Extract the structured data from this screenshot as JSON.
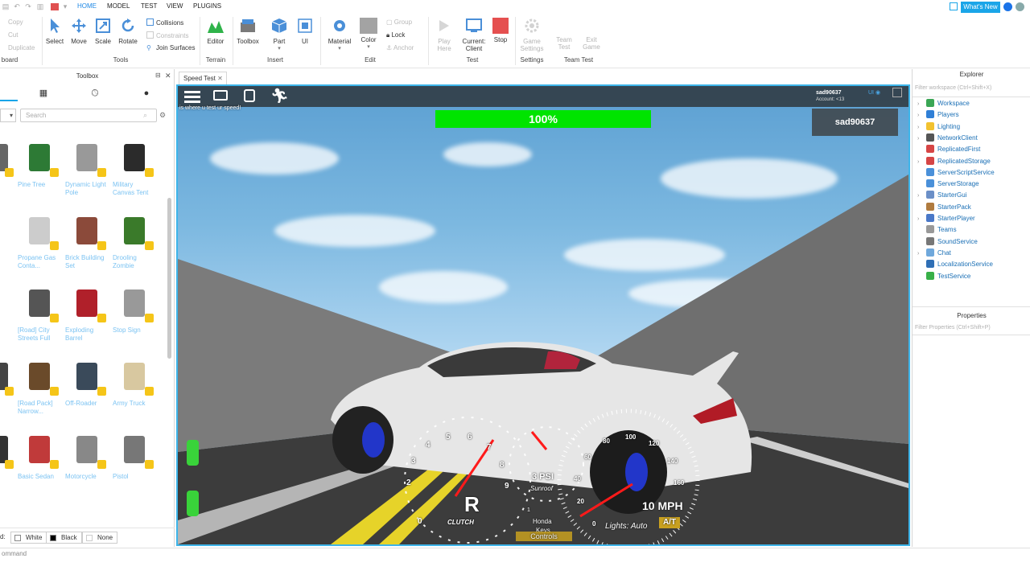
{
  "menu": {
    "tabs": [
      "HOME",
      "MODEL",
      "TEST",
      "VIEW",
      "PLUGINS"
    ],
    "active": "HOME",
    "whats_new": "What's New"
  },
  "ribbon": {
    "clipboard": {
      "copy": "Copy",
      "cut": "Cut",
      "duplicate": "Duplicate",
      "label": "board"
    },
    "tools": {
      "select": "Select",
      "move": "Move",
      "scale": "Scale",
      "rotate": "Rotate",
      "collisions": "Collisions",
      "constraints": "Constraints",
      "join_surfaces": "Join Surfaces",
      "label": "Tools"
    },
    "terrain": {
      "editor": "Editor",
      "label": "Terrain"
    },
    "insert": {
      "toolbox": "Toolbox",
      "part": "Part",
      "ui": "UI",
      "label": "Insert"
    },
    "edit": {
      "material": "Material",
      "color": "Color",
      "group": "Group",
      "lock": "Lock",
      "anchor": "Anchor",
      "label": "Edit"
    },
    "test": {
      "play_here_1": "Play",
      "play_here_2": "Here",
      "current_client_1": "Current:",
      "current_client_2": "Client",
      "stop": "Stop",
      "label": "Test"
    },
    "settings": {
      "game_settings_1": "Game",
      "game_settings_2": "Settings",
      "label": "Settings"
    },
    "team_test": {
      "team_test_1": "Team",
      "team_test_2": "Test",
      "exit_game_1": "Exit",
      "exit_game_2": "Game",
      "label": "Team Test"
    }
  },
  "toolbox": {
    "title": "Toolbox",
    "search_placeholder": "Search",
    "items": [
      {
        "label": "...ion",
        "col": 0,
        "row": 0
      },
      {
        "label": "Pine Tree",
        "col": 1,
        "row": 0
      },
      {
        "label": "Dynamic Light Pole",
        "col": 2,
        "row": 0
      },
      {
        "label": "Military Canvas Tent",
        "col": 3,
        "row": 0
      },
      {
        "label": "Propane Gas Conta...",
        "col": 1,
        "row": 1
      },
      {
        "label": "Brick Building Set",
        "col": 2,
        "row": 1
      },
      {
        "label": "Drooling Zombie",
        "col": 3,
        "row": 1
      },
      {
        "label": "[Road] City Streets Full",
        "col": 1,
        "row": 2
      },
      {
        "label": "Exploding Barrel",
        "col": 2,
        "row": 2
      },
      {
        "label": "Stop Sign",
        "col": 3,
        "row": 2
      },
      {
        "label": "ck] ...d...",
        "col": 0,
        "row": 3
      },
      {
        "label": "[Road Pack] Narrow...",
        "col": 1,
        "row": 3
      },
      {
        "label": "Off-Roader",
        "col": 2,
        "row": 3
      },
      {
        "label": "Army Truck",
        "col": 3,
        "row": 3
      },
      {
        "label": "ter",
        "col": 0,
        "row": 4
      },
      {
        "label": "Basic Sedan",
        "col": 1,
        "row": 4
      },
      {
        "label": "Motorcycle",
        "col": 2,
        "row": 4
      },
      {
        "label": "Pistol",
        "col": 3,
        "row": 4
      }
    ],
    "footer": {
      "prefix": "d:",
      "white": "White",
      "black": "Black",
      "none": "None"
    }
  },
  "viewport": {
    "tab_label": "Speed Test",
    "progress_text": "100%",
    "progress_fraction": 1.0,
    "player_name": "sad90637",
    "account_name": "sad90637",
    "account_sub": "Account: <13",
    "chat_line": "is where u test ur speed!",
    "hud": {
      "gear": "R",
      "clutch": "CLUTCH",
      "boost": "3 PSI",
      "sunroof": "Sunroof",
      "speed": "10 MPH",
      "lights": "Lights: Auto",
      "transmission": "A/T",
      "honda": "Honda",
      "keys": "Keys",
      "controls": "Controls",
      "one": "1",
      "tach_ticks": [
        "0",
        "1",
        "2",
        "3",
        "4",
        "5",
        "6",
        "7",
        "8",
        "9"
      ],
      "speed_ticks": [
        "0",
        "20",
        "40",
        "60",
        "80",
        "100",
        "120",
        "140",
        "160"
      ]
    }
  },
  "explorer": {
    "title": "Explorer",
    "filter_placeholder": "Filter workspace (Ctrl+Shift+X)",
    "items": [
      {
        "label": "Workspace",
        "expandable": true,
        "color": "#3aa655"
      },
      {
        "label": "Players",
        "expandable": true,
        "color": "#2f7fd6"
      },
      {
        "label": "Lighting",
        "expandable": true,
        "color": "#f2c230"
      },
      {
        "label": "NetworkClient",
        "expandable": true,
        "color": "#555555"
      },
      {
        "label": "ReplicatedFirst",
        "expandable": false,
        "color": "#d64545"
      },
      {
        "label": "ReplicatedStorage",
        "expandable": true,
        "color": "#d64545"
      },
      {
        "label": "ServerScriptService",
        "expandable": false,
        "color": "#4a90d9"
      },
      {
        "label": "ServerStorage",
        "expandable": false,
        "color": "#4a90d9"
      },
      {
        "label": "StarterGui",
        "expandable": true,
        "color": "#6b8fc7"
      },
      {
        "label": "StarterPack",
        "expandable": false,
        "color": "#b07b3f"
      },
      {
        "label": "StarterPlayer",
        "expandable": true,
        "color": "#4a78c8"
      },
      {
        "label": "Teams",
        "expandable": false,
        "color": "#999999"
      },
      {
        "label": "SoundService",
        "expandable": false,
        "color": "#777777"
      },
      {
        "label": "Chat",
        "expandable": true,
        "color": "#6fa8dc"
      },
      {
        "label": "LocalizationService",
        "expandable": false,
        "color": "#2f6fb5"
      },
      {
        "label": "TestService",
        "expandable": false,
        "color": "#38b048"
      }
    ],
    "properties_title": "Properties",
    "properties_filter": "Filter Properties (Ctrl+Shift+P)"
  },
  "command_bar": {
    "placeholder": "ommand"
  }
}
